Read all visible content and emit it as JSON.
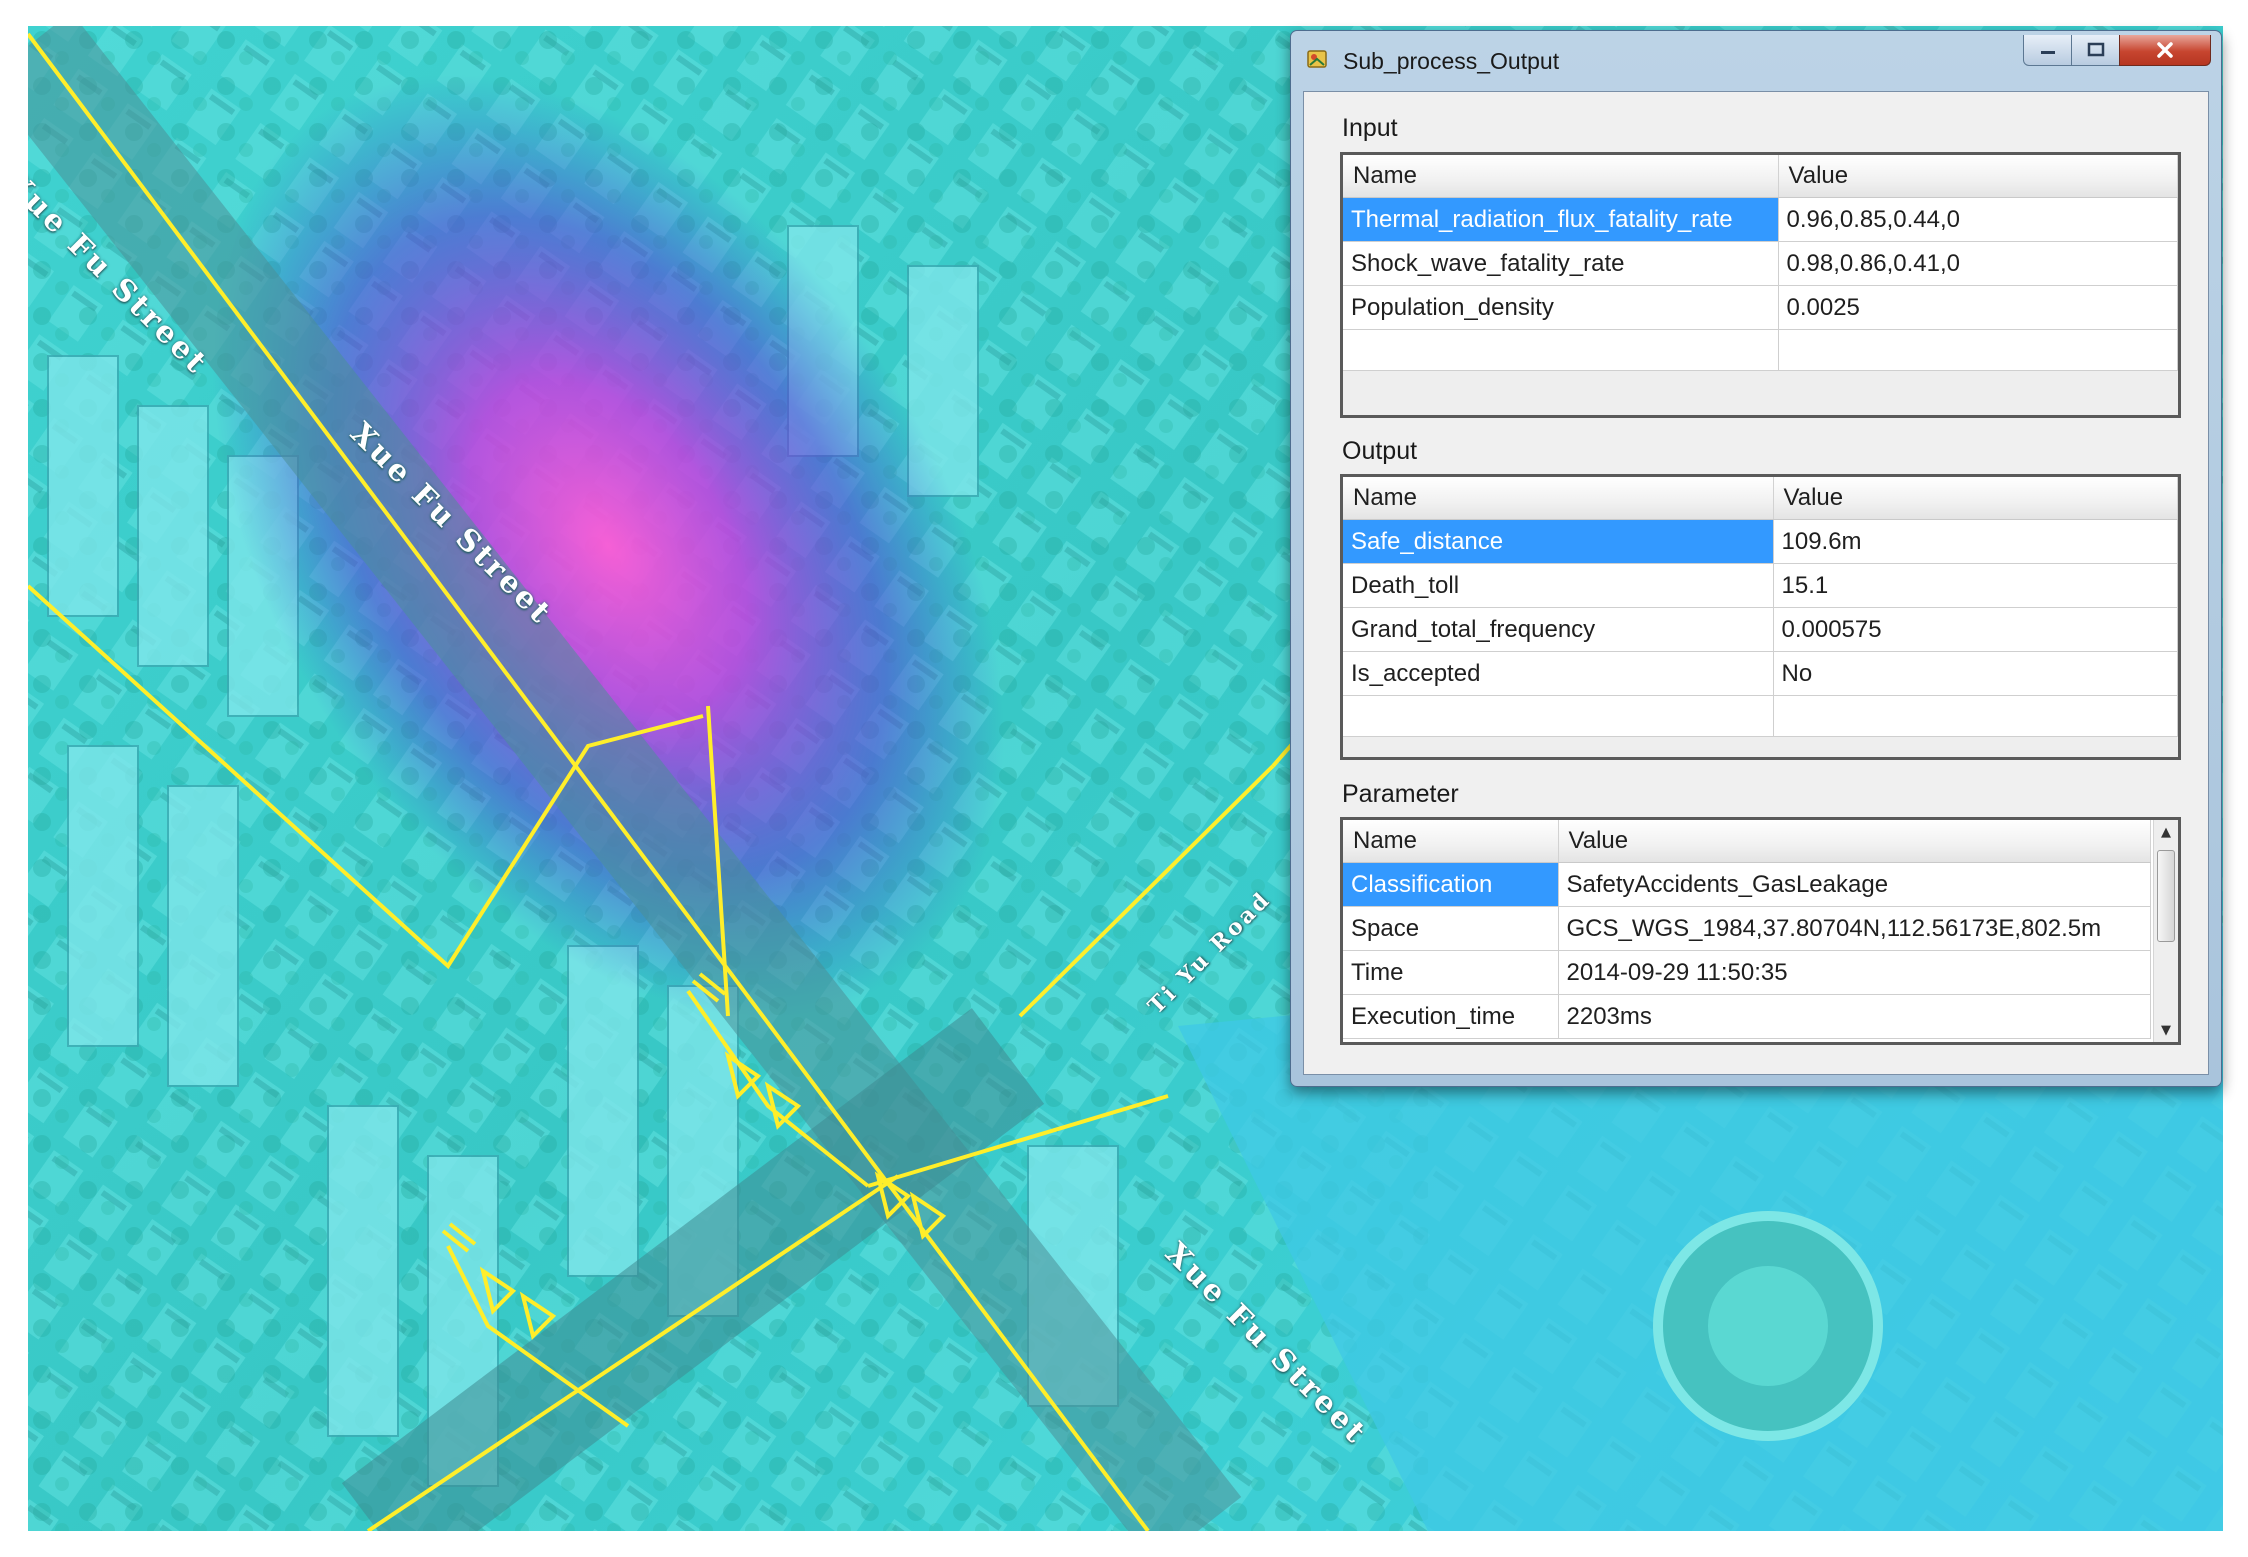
{
  "map": {
    "street_labels": {
      "upper_left": "Xue Fu Street",
      "center": "Xue Fu Street",
      "lower_right": "Xue Fu Street",
      "side_road": "Ti Yu Road"
    },
    "colors": {
      "road_line": "#ffee2a",
      "heat_core": "#ff5ad6",
      "heat_mid": "#7a3ce8",
      "water": "#40c8ea"
    }
  },
  "dialog": {
    "title": "Sub_process_Output",
    "icons": {
      "app": "app-icon",
      "minimize": "minimize-icon",
      "maximize": "maximize-icon",
      "close": "close-icon"
    },
    "input": {
      "label": "Input",
      "columns": [
        "Name",
        "Value"
      ],
      "rows": [
        {
          "name": "Thermal_radiation_flux_fatality_rate",
          "value": "0.96,0.85,0.44,0",
          "selected": true
        },
        {
          "name": "Shock_wave_fatality_rate",
          "value": "0.98,0.86,0.41,0"
        },
        {
          "name": "Population_density",
          "value": "0.0025"
        }
      ]
    },
    "output": {
      "label": "Output",
      "columns": [
        "Name",
        "Value"
      ],
      "rows": [
        {
          "name": "Safe_distance",
          "value": "109.6m",
          "selected": true
        },
        {
          "name": "Death_toll",
          "value": "15.1"
        },
        {
          "name": "Grand_total_frequency",
          "value": "0.000575"
        },
        {
          "name": "Is_accepted",
          "value": "No"
        }
      ]
    },
    "parameter": {
      "label": "Parameter",
      "columns": [
        "Name",
        "Value"
      ],
      "rows": [
        {
          "name": "Classification",
          "value": "SafetyAccidents_GasLeakage",
          "selected": true
        },
        {
          "name": "Space",
          "value": "GCS_WGS_1984,37.80704N,112.56173E,802.5m"
        },
        {
          "name": "Time",
          "value": "2014-09-29 11:50:35"
        },
        {
          "name": "Execution_time",
          "value": "2203ms"
        }
      ]
    }
  }
}
